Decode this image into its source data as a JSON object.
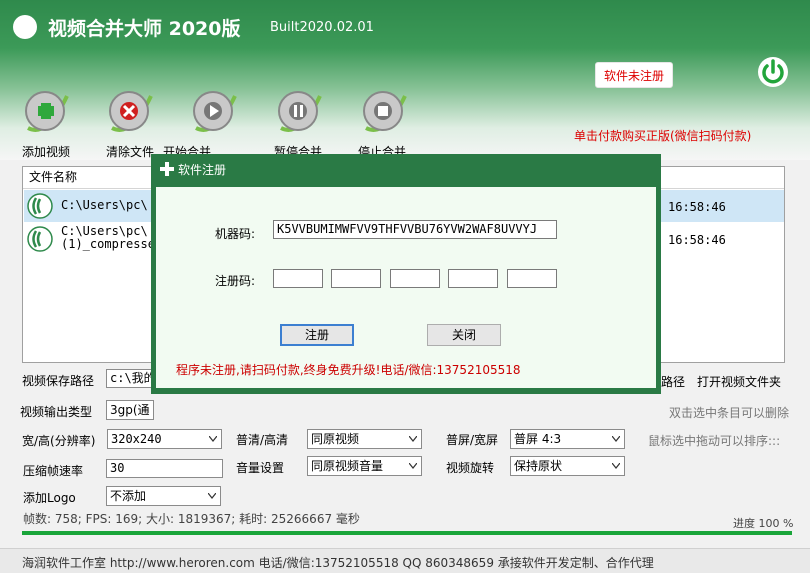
{
  "header": {
    "title": "视频合并大师 2020版",
    "build": "Built2020.02.01",
    "register_badge": "软件未注册",
    "pay_link": "单击付款购买正版(微信扫码付款)"
  },
  "toolbar": [
    {
      "label": "添加视频",
      "icon": "add-icon"
    },
    {
      "label": "清除文件",
      "icon": "delete-icon"
    },
    {
      "label": "开始合并",
      "icon": "play-icon"
    },
    {
      "label": "暂停合并",
      "icon": "pause-icon"
    },
    {
      "label": "停止合并",
      "icon": "stop-icon"
    }
  ],
  "file_list": {
    "header": "文件名称",
    "rows": [
      {
        "path_line1": "C:\\Users\\pc\\",
        "path_line2": "",
        "time": "16:58:46"
      },
      {
        "path_line1": "C:\\Users\\pc\\",
        "path_line2": "(1)_compresse",
        "time": "16:58:46"
      }
    ]
  },
  "settings": {
    "save_path_label": "视频保存路径",
    "save_path_value": "c:\\我的",
    "path_link": "路径",
    "open_folder_link": "打开视频文件夹",
    "output_type_label": "视频输出类型",
    "output_type_value": "3gp(通",
    "hint_dblclick": "双击选中条目可以删除",
    "size_label": "宽/高(分辨率)",
    "size_value": "320x240",
    "quality_label": "普清/高清",
    "quality_value": "同原视频",
    "screen_label": "普屏/宽屏",
    "screen_value": "普屏 4:3",
    "hint_drag": "鼠标选中拖动可以排序:::",
    "fps_label": "压缩帧速率",
    "fps_value": "30",
    "volume_label": "音量设置",
    "volume_value": "同原视频音量",
    "rotate_label": "视频旋转",
    "rotate_value": "保持原状",
    "logo_label": "添加Logo",
    "logo_value": "不添加"
  },
  "status": {
    "stats": "帧数: 758; FPS: 169; 大小: 1819367; 耗时: 25266667 毫秒",
    "progress_label": "进度 100 %",
    "progress_fraction": 1.0
  },
  "footer": {
    "text": "海润软件工作室 http://www.heroren.com  电话/微信:13752105518  QQ 860348659 承接软件开发定制、合作代理"
  },
  "dialog": {
    "title": "软件注册",
    "machine_code_label": "机器码:",
    "machine_code_value": "K5VVBUMIMWFVV9THFVVBU76YVW2WAF8UVVYJ",
    "reg_code_label": "注册码:",
    "reg_code_parts": [
      "",
      "",
      "",
      "",
      ""
    ],
    "register_button": "注册",
    "close_button": "关闭",
    "warning": "程序未注册,请扫码付款,终身免费升级!电话/微信:13752105518"
  },
  "colors": {
    "title_green": "#2f8a4c",
    "dialog_green": "#2a7a45",
    "warning_red": "#cc0000",
    "progress_green": "#1aa53a"
  }
}
